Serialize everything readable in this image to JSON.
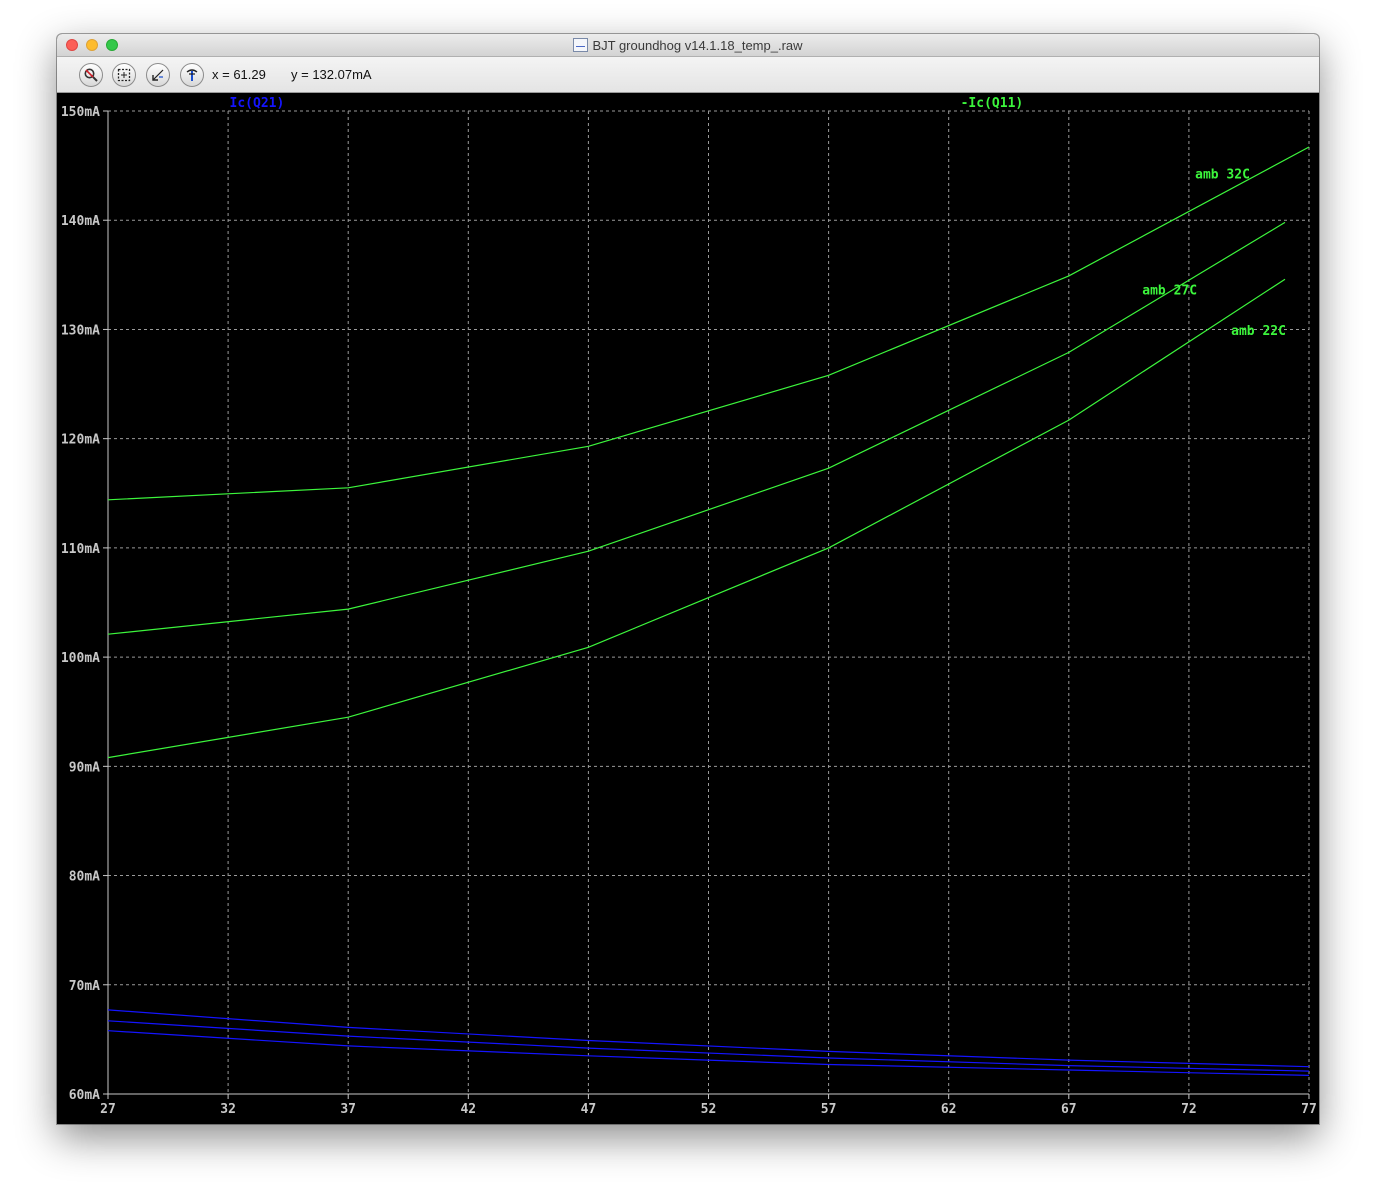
{
  "window": {
    "title": "BJT groundhog v14.1.18_temp_.raw"
  },
  "toolbar": {
    "buttons": [
      {
        "icon": "zoom-to-fit-icon"
      },
      {
        "icon": "zoom-area-icon"
      },
      {
        "icon": "zoom-back-icon"
      },
      {
        "icon": "probe-icon"
      }
    ],
    "x_readout": "x = 61.29",
    "y_readout": "y = 132.07mA"
  },
  "colors": {
    "background": "#000000",
    "grid": "#9a9a9a",
    "axis_text": "#c8c8c8",
    "green_trace": "#3cf53c",
    "blue_trace": "#1414ff"
  },
  "chart_data": {
    "type": "line",
    "xlim": [
      27,
      77
    ],
    "ylim": [
      60,
      150
    ],
    "y_unit": "mA",
    "x_ticks": [
      "27",
      "32",
      "37",
      "42",
      "47",
      "52",
      "57",
      "62",
      "67",
      "72",
      "77"
    ],
    "y_ticks": [
      "60mA",
      "70mA",
      "80mA",
      "90mA",
      "100mA",
      "110mA",
      "120mA",
      "130mA",
      "140mA",
      "150mA"
    ],
    "trace_labels": [
      {
        "text": "Ic(Q21)",
        "color": "#1414ff"
      },
      {
        "text": "-Ic(Q11)",
        "color": "#3cf53c"
      }
    ],
    "annotations": [
      "amb 32C",
      "amb 27C",
      "amb 22C"
    ],
    "grid": true,
    "series": [
      {
        "name": "amb 32C",
        "color": "#3cf53c",
        "x": [
          27,
          37,
          47,
          57,
          67,
          77
        ],
        "y": [
          114.4,
          115.5,
          119.3,
          125.8,
          134.9,
          146.7
        ]
      },
      {
        "name": "amb 27C",
        "color": "#3cf53c",
        "x": [
          27,
          37,
          47,
          57,
          67,
          76
        ],
        "y": [
          102.1,
          104.4,
          109.7,
          117.3,
          127.9,
          139.8
        ]
      },
      {
        "name": "amb 22C",
        "color": "#3cf53c",
        "x": [
          27,
          37,
          47,
          57,
          67,
          76
        ],
        "y": [
          90.8,
          94.5,
          100.9,
          110.0,
          121.7,
          134.6
        ]
      },
      {
        "color": "#1414ff",
        "x": [
          27,
          37,
          47,
          57,
          67,
          77
        ],
        "y": [
          67.7,
          66.1,
          64.9,
          63.9,
          63.1,
          62.5
        ]
      },
      {
        "color": "#1414ff",
        "x": [
          27,
          37,
          47,
          57,
          67,
          77
        ],
        "y": [
          66.7,
          65.3,
          64.2,
          63.3,
          62.6,
          62.1
        ]
      },
      {
        "color": "#1414ff",
        "x": [
          27,
          37,
          47,
          57,
          67,
          77
        ],
        "y": [
          65.8,
          64.4,
          63.5,
          62.7,
          62.2,
          61.7
        ]
      }
    ]
  }
}
